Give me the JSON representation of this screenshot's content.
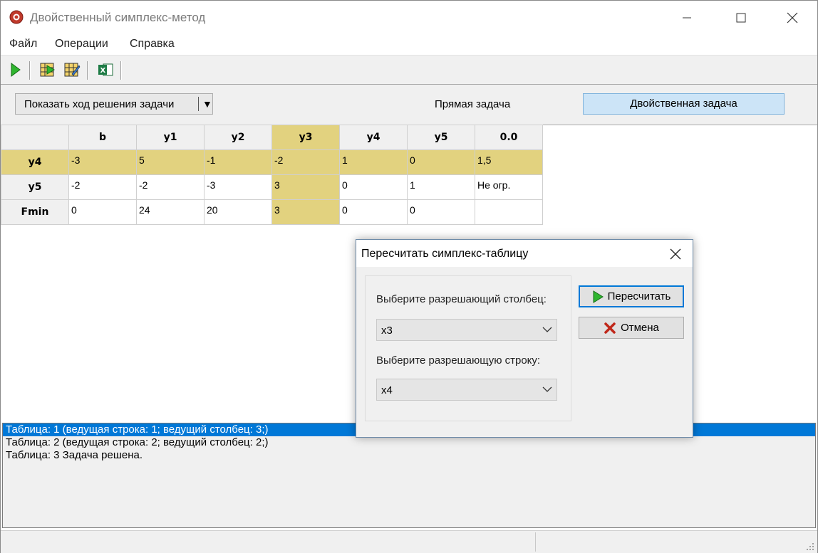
{
  "window": {
    "title": "Двойственный симплекс-метод",
    "icon": "app-icon",
    "controls": [
      "minimize-icon",
      "maximize-icon",
      "close-icon"
    ]
  },
  "menu": {
    "file": "Файл",
    "operations": "Операции",
    "help": "Справка"
  },
  "toolbar": {
    "buttons": [
      "run-icon",
      "next-step-icon",
      "table-edit-icon",
      "excel-icon"
    ]
  },
  "panel": {
    "show_solution": "Показать ход решения задачи",
    "direct_problem": "Прямая задача",
    "dual_problem": "Двойственная задача"
  },
  "grid": {
    "headers": [
      "",
      "b",
      "y1",
      "y2",
      "y3",
      "y4",
      "y5",
      "0.0"
    ],
    "rows": [
      {
        "label": "y4",
        "cells": [
          "-3",
          "5",
          "-1",
          "-2",
          "1",
          "0",
          "1,5"
        ]
      },
      {
        "label": "y5",
        "cells": [
          "-2",
          "-2",
          "-3",
          "3",
          "0",
          "1",
          "Не огр."
        ]
      },
      {
        "label": "Fmin",
        "cells": [
          "0",
          "24",
          "20",
          "3",
          "0",
          "0",
          ""
        ]
      }
    ],
    "highlight_color": "#e2d27f"
  },
  "log": {
    "items": [
      "Таблица: 1 (ведущая строка: 1; ведущий столбец: 3;)",
      "Таблица: 2 (ведущая строка: 2; ведущий столбец: 2;)",
      "Таблица: 3 Задача решена."
    ],
    "selected_color": "#0078d7"
  },
  "dialog": {
    "title": "Пересчитать симплекс-таблицу",
    "column_label": "Выберите разрешающий столбец:",
    "column_value": "x3",
    "row_label": "Выберите разрешающую строку:",
    "row_value": "x4",
    "recalc_button": "Пересчитать",
    "cancel_button": "Отмена"
  }
}
